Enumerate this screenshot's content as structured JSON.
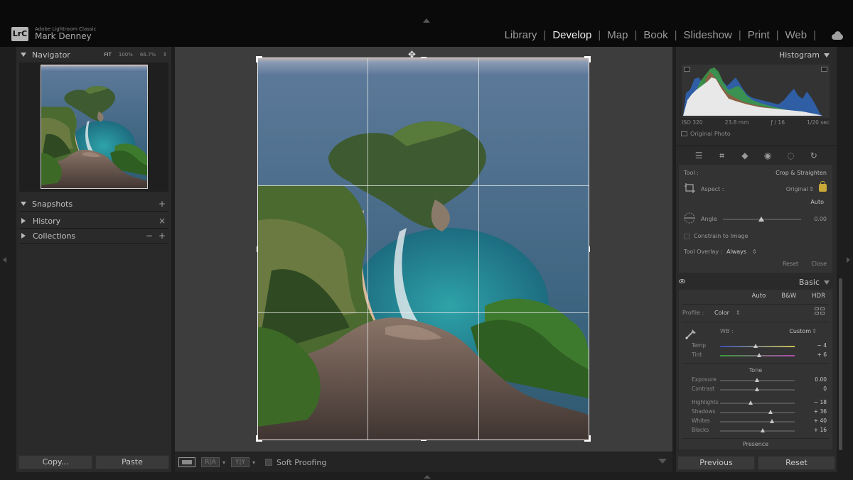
{
  "app": {
    "name": "Adobe Lightroom Classic",
    "logo": "LrC",
    "user": "Mark Denney"
  },
  "modules": [
    "Library",
    "Develop",
    "Map",
    "Book",
    "Slideshow",
    "Print",
    "Web"
  ],
  "active_module": "Develop",
  "left_panel": {
    "navigator": {
      "title": "Navigator",
      "zoom_fit": "FIT",
      "zoom_100": "100%",
      "zoom_custom": "66.7%",
      "zoom_arrows": "⇕"
    },
    "snapshots": {
      "title": "Snapshots",
      "action": "+"
    },
    "history": {
      "title": "History",
      "action": "×"
    },
    "collections": {
      "title": "Collections",
      "minus": "−",
      "plus": "+"
    },
    "copy_label": "Copy...",
    "paste_label": "Paste"
  },
  "toolbar": {
    "view_ba_1": "R|A",
    "view_ba_2": "Y|Y",
    "soft_proofing": "Soft Proofing"
  },
  "right_panel": {
    "histogram": {
      "title": "Histogram",
      "iso": "ISO 320",
      "focal": "23.8 mm",
      "aperture": "ƒ / 16",
      "shutter": "1/20 sec",
      "original_photo": "Original Photo"
    },
    "crop": {
      "tool_label": "Tool :",
      "tool_value": "Crop & Straighten",
      "aspect_label": "Aspect :",
      "aspect_value": "Original",
      "auto_label": "Auto",
      "angle_label": "Angle",
      "angle_value": "0.00",
      "constrain_label": "Constrain to Image",
      "overlay_label": "Tool Overlay :",
      "overlay_value": "Always",
      "reset_label": "Reset",
      "close_label": "Close"
    },
    "basic": {
      "title": "Basic",
      "treatment": [
        "Auto",
        "B&W",
        "HDR"
      ],
      "profile_label": "Profile :",
      "profile_value": "Color",
      "wb_label": "WB :",
      "wb_value": "Custom",
      "tone_label": "Tone",
      "presence_label": "Presence",
      "adjustments": [
        {
          "label": "Temp",
          "value": "− 4",
          "pos": 0.48
        },
        {
          "label": "Tint",
          "value": "+ 6",
          "pos": 0.53
        },
        {
          "label": "Exposure",
          "value": "0.00",
          "pos": 0.5
        },
        {
          "label": "Contrast",
          "value": "0",
          "pos": 0.5
        },
        {
          "label": "Highlights",
          "value": "− 18",
          "pos": 0.41
        },
        {
          "label": "Shadows",
          "value": "+ 36",
          "pos": 0.68
        },
        {
          "label": "Whites",
          "value": "+ 40",
          "pos": 0.7
        },
        {
          "label": "Blacks",
          "value": "+ 16",
          "pos": 0.58
        }
      ]
    },
    "previous_label": "Previous",
    "reset_label": "Reset"
  },
  "colors": {
    "background": "#1e1e1e",
    "panel": "#2a2a2a",
    "center": "#3d3d3d",
    "topbar": "#0a0a0a",
    "lock": "#c8a838"
  }
}
